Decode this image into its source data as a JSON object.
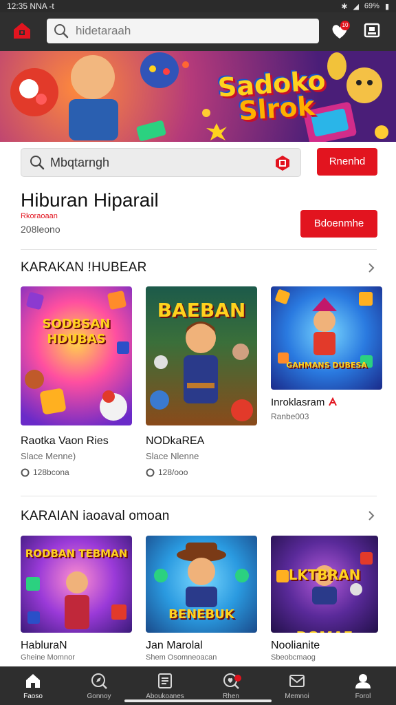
{
  "status": {
    "time": "12:35 NNA -t",
    "battery": "69%"
  },
  "topbar": {
    "search_placeholder": "hidetaraah",
    "notif_count": "10"
  },
  "banner": {
    "title_line1": "Sadoko",
    "title_line2": "Slrok"
  },
  "search2": {
    "placeholder": "Mbqtarngh",
    "button": "Rnenhd"
  },
  "page": {
    "title": "Hiburan Hiparail",
    "subtitle_red": "Rkoraoaan",
    "subtitle_grey": "208leono",
    "subscribe": "Bdoenmhe"
  },
  "sections": [
    {
      "title": "KARAKAN !HUBEAR",
      "cards": [
        {
          "name": "Raotka Vaon Ries",
          "sub": "Slace Menne)",
          "meta": "128bcona",
          "thumb_text": "SODBSAN HDUBAS"
        },
        {
          "name": "NODkaREA",
          "sub": "Slace Nlenne",
          "meta": "128/ooo",
          "thumb_text": "BAEBAN"
        },
        {
          "name": "Inroklasram",
          "sub": "Ranbe003",
          "meta": "",
          "thumb_text": "GAHMANS DUBESA"
        }
      ]
    },
    {
      "title": "KARAIAN iaoaval omoan",
      "cards": [
        {
          "name": "HabluraN",
          "sub": "Gheine Momnor",
          "thumb_text": "RODBAN TEBMAN"
        },
        {
          "name": "Jan Marolal",
          "sub": "Shem Osomneoacan",
          "thumb_text": "BENEBUK"
        },
        {
          "name": "Noolianite",
          "sub": "Sbeobcmaog",
          "thumb_text": "LKTBRAN DOMAE"
        }
      ]
    }
  ],
  "nav": [
    {
      "label": "Faoso",
      "icon": "home-icon"
    },
    {
      "label": "Gonnoy",
      "icon": "explore-icon"
    },
    {
      "label": "Aboukoanes",
      "icon": "list-icon"
    },
    {
      "label": "Rhen",
      "icon": "search-heart-icon"
    },
    {
      "label": "Memnoi",
      "icon": "inbox-icon"
    },
    {
      "label": "Forol",
      "icon": "profile-icon"
    }
  ],
  "colors": {
    "accent": "#e2141f",
    "topbar": "#2f2f2f",
    "nav": "#2e2e2e"
  }
}
